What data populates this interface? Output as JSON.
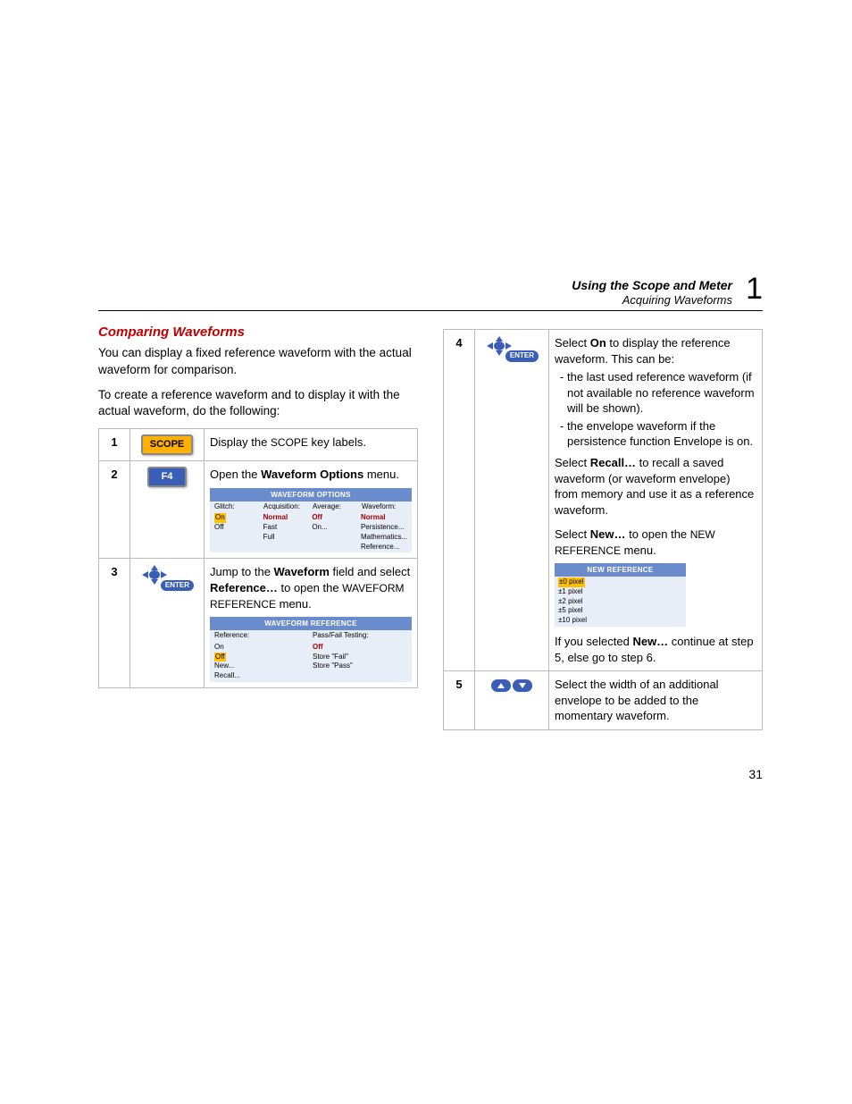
{
  "header": {
    "line1": "Using the Scope and Meter",
    "line2": "Acquiring Waveforms",
    "chapter": "1"
  },
  "left": {
    "title": "Comparing Waveforms",
    "p1": "You can display a fixed reference waveform with the actual waveform for comparison.",
    "p2": "To create a reference waveform and to display it with the actual waveform, do the following:",
    "steps": {
      "s1": {
        "num": "1",
        "btn": "SCOPE",
        "text_pre": "Display the ",
        "text_sc": "SCOPE",
        "text_post": " key labels."
      },
      "s2": {
        "num": "2",
        "btn": "F4",
        "text_pre": "Open the ",
        "text_b": "Waveform Options",
        "text_post": " menu."
      },
      "s3": {
        "num": "3",
        "enter": "ENTER",
        "t1": "Jump to the ",
        "t1b": "Waveform",
        "t1a": " field and select ",
        "t2b": "Reference…",
        "t2a": " to open the ",
        "t3sc": "WAVEFORM REFERENCE",
        "t3a": " menu."
      }
    },
    "menu_opts": {
      "title": "WAVEFORM OPTIONS",
      "h": [
        "Glitch:",
        "Acquisition:",
        "Average:",
        "Waveform:"
      ],
      "c1": [
        "On",
        "Off"
      ],
      "c2": [
        "Normal",
        "Fast",
        "Full"
      ],
      "c3": [
        "Off",
        "On..."
      ],
      "c4": [
        "Normal",
        "Persistence...",
        "Mathematics...",
        "Reference..."
      ]
    },
    "menu_ref": {
      "title": "WAVEFORM REFERENCE",
      "lh": "Reference:",
      "rh": "Pass/Fail Testing:",
      "l": [
        "On",
        "Off",
        "New...",
        "Recall..."
      ],
      "r": [
        "Off",
        "Store \"Fail\"",
        "Store \"Pass\""
      ]
    }
  },
  "right": {
    "s4": {
      "num": "4",
      "enter": "ENTER",
      "a1": "Select ",
      "a1b": "On",
      "a1p": " to display the reference waveform. This can be:",
      "b1": "the last used reference waveform (if not available no reference waveform will be shown).",
      "b2": "the envelope waveform if the persistence function Envelope is on.",
      "c1": "Select ",
      "c1b": "Recall…",
      "c1p": " to recall a saved waveform (or waveform envelope) from memory and use it as a reference waveform.",
      "d1": "Select ",
      "d1b": "New…",
      "d1p": " to open the ",
      "d1sc": "NEW REFERENCE",
      "d1p2": " menu.",
      "e1": "If you selected ",
      "e1b": "New…",
      "e1p": " continue at step 5, else go to step 6."
    },
    "menu_new": {
      "title": "NEW REFERENCE",
      "items": [
        "±0 pixel",
        "±1 pixel",
        "±2 pixel",
        "±5 pixel",
        "±10 pixel"
      ]
    },
    "s5": {
      "num": "5",
      "text": "Select the width of an additional envelope to be added to the momentary waveform."
    }
  },
  "page_number": "31"
}
